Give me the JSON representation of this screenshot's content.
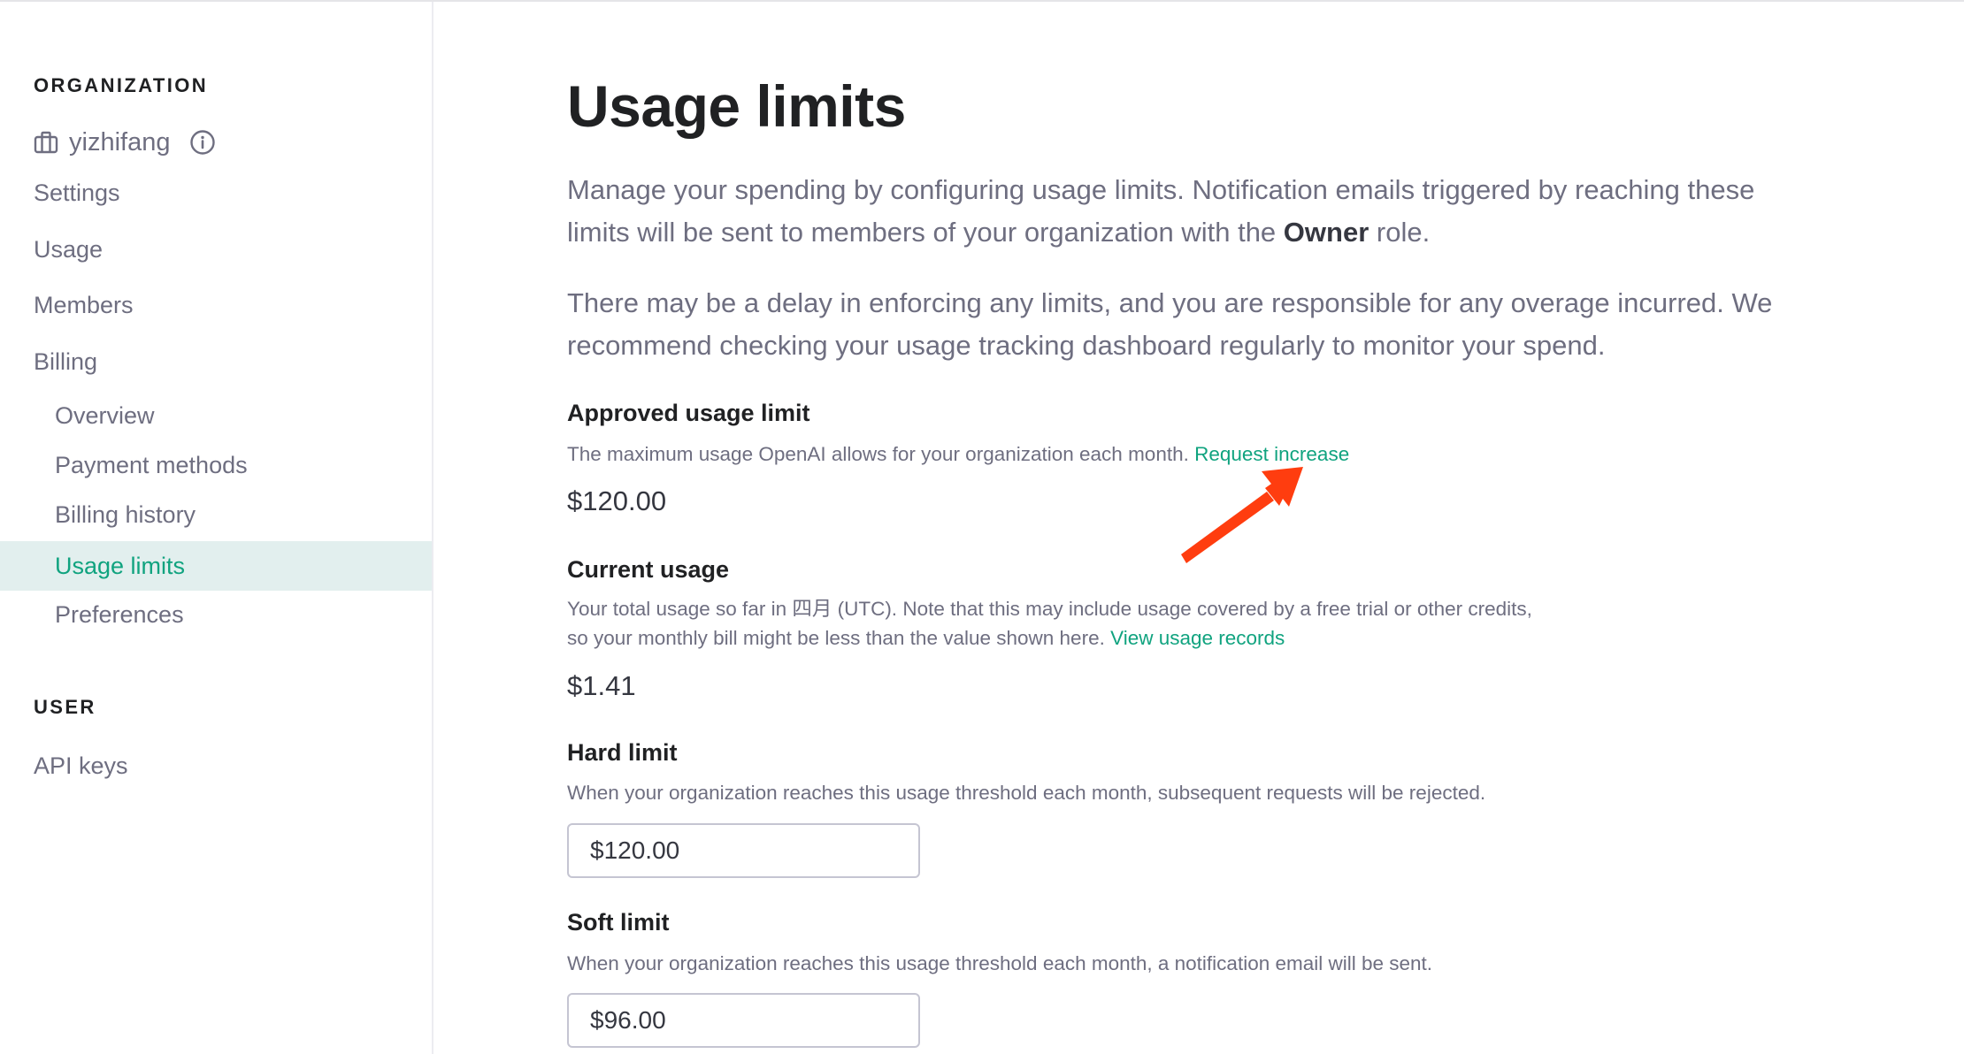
{
  "sidebar": {
    "organization_heading": "ORGANIZATION",
    "org_icon": "briefcase-icon",
    "org_name": "yizhifang",
    "org_info_icon": "info-icon",
    "items": [
      {
        "label": "Settings",
        "level": 1,
        "active": false
      },
      {
        "label": "Usage",
        "level": 1,
        "active": false
      },
      {
        "label": "Members",
        "level": 1,
        "active": false
      },
      {
        "label": "Billing",
        "level": 1,
        "active": false
      },
      {
        "label": "Overview",
        "level": 2,
        "active": false
      },
      {
        "label": "Payment methods",
        "level": 2,
        "active": false
      },
      {
        "label": "Billing history",
        "level": 2,
        "active": false
      },
      {
        "label": "Usage limits",
        "level": 2,
        "active": true
      },
      {
        "label": "Preferences",
        "level": 2,
        "active": false
      }
    ],
    "user_heading": "USER",
    "user_items": [
      {
        "label": "API keys",
        "level": 1,
        "active": false
      }
    ]
  },
  "main": {
    "title": "Usage limits",
    "intro1": {
      "line1": "Manage your spending by configuring usage limits. Notification emails triggered by reaching these",
      "line2_before": "limits will be sent to members of your organization with the ",
      "line2_bold": "Owner",
      "line2_after": " role."
    },
    "intro2": {
      "line1": "There may be a delay in enforcing any limits, and you are responsible for any overage incurred. We",
      "line2": "recommend checking your usage tracking dashboard regularly to monitor your spend."
    },
    "approved": {
      "title": "Approved usage limit",
      "description": "The maximum usage OpenAI allows for your organization each month. ",
      "link": "Request increase",
      "value": "$120.00"
    },
    "current": {
      "title": "Current usage",
      "description_line1": "Your total usage so far in 四月 (UTC). Note that this may include usage covered by a free trial or other credits,",
      "description_line2": "so your monthly bill might be less than the value shown here. ",
      "link": "View usage records",
      "value": "$1.41"
    },
    "hard_limit": {
      "title": "Hard limit",
      "description": "When your organization reaches this usage threshold each month, subsequent requests will be rejected.",
      "value": "$120.00"
    },
    "soft_limit": {
      "title": "Soft limit",
      "description": "When your organization reaches this usage threshold each month, a notification email will be sent.",
      "value": "$96.00"
    }
  },
  "annotation": {
    "type": "arrow",
    "color": "#ff3d0f",
    "points_to": "Request increase"
  },
  "colors": {
    "accent": "#10a37f",
    "active_bg": "#e2efee",
    "text_muted": "#6e6e80",
    "text_strong": "#202123"
  }
}
